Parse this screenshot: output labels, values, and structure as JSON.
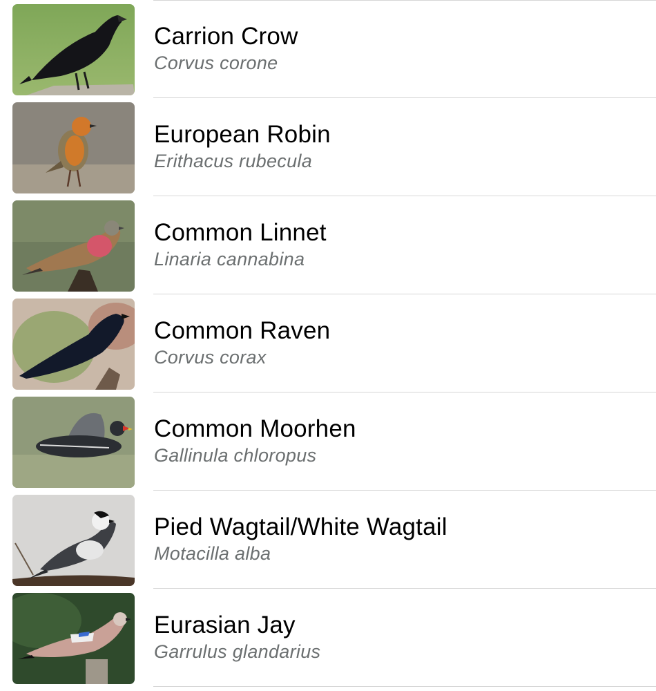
{
  "birds": [
    {
      "common_name": "Carrion Crow",
      "scientific_name": "Corvus corone",
      "photo": "carrion-crow-photo"
    },
    {
      "common_name": "European Robin",
      "scientific_name": "Erithacus rubecula",
      "photo": "european-robin-photo"
    },
    {
      "common_name": "Common Linnet",
      "scientific_name": "Linaria cannabina",
      "photo": "common-linnet-photo"
    },
    {
      "common_name": "Common Raven",
      "scientific_name": "Corvus corax",
      "photo": "common-raven-photo"
    },
    {
      "common_name": "Common Moorhen",
      "scientific_name": "Gallinula chloropus",
      "photo": "common-moorhen-photo"
    },
    {
      "common_name": "Pied Wagtail/White Wagtail",
      "scientific_name": "Motacilla alba",
      "photo": "pied-wagtail-photo"
    },
    {
      "common_name": "Eurasian Jay",
      "scientific_name": "Garrulus glandarius",
      "photo": "eurasian-jay-photo"
    }
  ]
}
